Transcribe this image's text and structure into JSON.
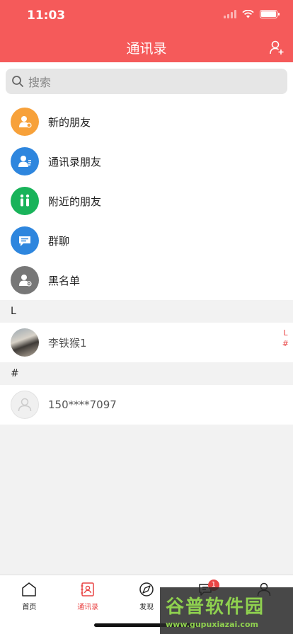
{
  "status_bar": {
    "time": "11:03"
  },
  "header": {
    "title": "通讯录"
  },
  "search": {
    "placeholder": "搜索"
  },
  "menu": {
    "items": [
      {
        "label": "新的朋友",
        "color": "#f7a13a"
      },
      {
        "label": "通讯录朋友",
        "color": "#2e86de"
      },
      {
        "label": "附近的朋友",
        "color": "#19b35a"
      },
      {
        "label": "群聊",
        "color": "#2e86de"
      },
      {
        "label": "黑名单",
        "color": "#777777"
      }
    ]
  },
  "sections": [
    {
      "letter": "L",
      "contacts": [
        {
          "name": "李铁猴1"
        }
      ]
    },
    {
      "letter": "#",
      "contacts": [
        {
          "name": "150****7097"
        }
      ]
    }
  ],
  "index_bar": [
    "L",
    "#"
  ],
  "tabbar": {
    "tabs": [
      {
        "label": "首页"
      },
      {
        "label": "通讯录"
      },
      {
        "label": "发现"
      },
      {
        "label": "",
        "badge": "1"
      },
      {
        "label": ""
      }
    ],
    "active_color": "#e94545"
  },
  "watermark": {
    "title": "谷普软件园",
    "url": "www.gupuxiazai.com"
  }
}
